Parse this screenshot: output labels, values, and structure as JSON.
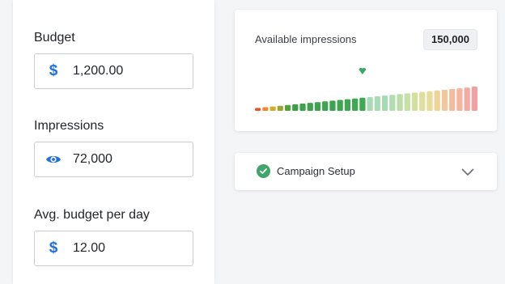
{
  "budget": {
    "label": "Budget",
    "value": "1,200.00",
    "icon": "dollar-icon",
    "icon_glyph": "$"
  },
  "impressions": {
    "label": "Impressions",
    "value": "72,000",
    "icon": "eye-icon"
  },
  "avg_budget": {
    "label": "Avg. budget per day",
    "value": "12.00",
    "icon": "dollar-icon",
    "icon_glyph": "$"
  },
  "available_impressions": {
    "title": "Available impressions",
    "badge": "150,000",
    "marker_color": "#3fa56b",
    "bar_heights": [
      0.12,
      0.15,
      0.18,
      0.21,
      0.24,
      0.27,
      0.3,
      0.33,
      0.36,
      0.39,
      0.42,
      0.45,
      0.48,
      0.51,
      0.54,
      0.57,
      0.6,
      0.63,
      0.66,
      0.69,
      0.72,
      0.75,
      0.78,
      0.81,
      0.84,
      0.87,
      0.9,
      0.93,
      0.96,
      1.0
    ],
    "bar_colors": [
      "#e8542c",
      "#ee8a2a",
      "#cfae2a",
      "#9aa92d",
      "#56a33b",
      "#3d9f48",
      "#3ea14c",
      "#3fa24d",
      "#3fa34e",
      "#3fa44f",
      "#3fa450",
      "#3fa550",
      "#3fa651",
      "#3fa752",
      "#3fa853",
      "#a9dcb6",
      "#a9dcb6",
      "#a8dbb3",
      "#b2ddb0",
      "#bcdfaa",
      "#c6e0a5",
      "#d2e0a0",
      "#dedf9e",
      "#e9db9a",
      "#efd399",
      "#f2c89b",
      "#f3bd9d",
      "#f3b4a0",
      "#f2aaa1",
      "#f1a1a0"
    ],
    "marker_index": 14
  },
  "campaign_setup": {
    "label": "Campaign Setup",
    "status_icon": "check-circle-icon",
    "status_color": "#3fa56b",
    "chevron": "chevron-down-icon"
  }
}
